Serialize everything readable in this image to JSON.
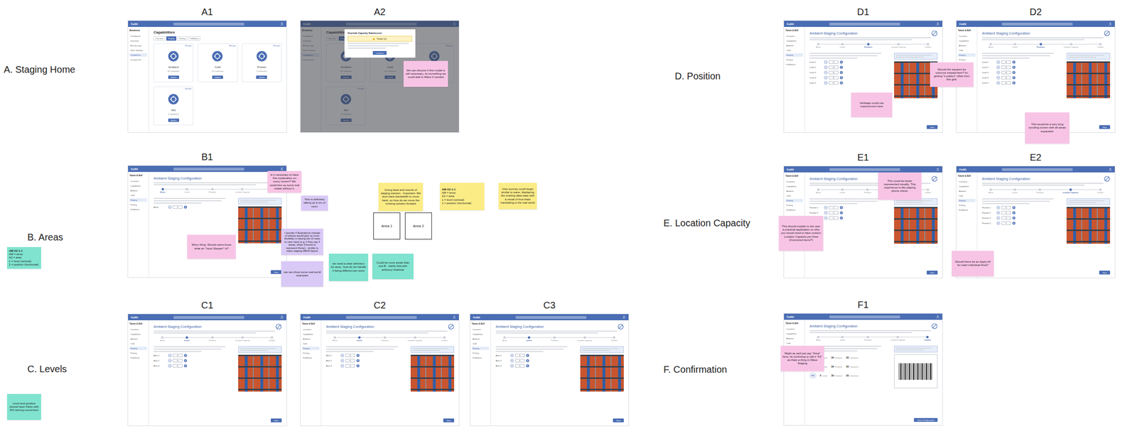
{
  "sections": [
    "A. Staging Home",
    "B. Areas",
    "C. Levels",
    "D. Position",
    "E. Location Capacity",
    "F. Confirmation"
  ],
  "app": {
    "brand": "Fulfill"
  },
  "sidebars": {
    "home": {
      "store": "Benamout",
      "items": [
        {
          "label": "Dashboard",
          "selected": false
        },
        {
          "label": "Inventory",
          "selected": false
        },
        {
          "label": "Activity Logs",
          "selected": false
        },
        {
          "label": "Store Settings",
          "selected": false
        },
        {
          "label": "Capabilities",
          "selected": true
        },
        {
          "label": "Location IDs",
          "selected": false
        }
      ]
    },
    "config": {
      "store": "Tatum & Bell",
      "items": [
        {
          "label": "Locations",
          "selected": false
        },
        {
          "label": "Capabilities",
          "selected": false
        },
        {
          "label": "Ambient",
          "selected": false
        },
        {
          "label": "Cold",
          "selected": false
        },
        {
          "label": "Staging",
          "selected": true
        },
        {
          "label": "Picking",
          "selected": false
        },
        {
          "label": "Fulfillment",
          "selected": false
        }
      ]
    }
  },
  "capabilities": {
    "title": "Capabilities",
    "tabs": [
      {
        "label": "Overview",
        "selected": false
      },
      {
        "label": "Staging",
        "selected": true
      },
      {
        "label": "Picking",
        "selected": false
      },
      {
        "label": "Fulfillment",
        "selected": false
      }
    ],
    "cards": [
      {
        "name": "Ambient",
        "count": "60 Containers",
        "manage": "Manage",
        "action": "Update"
      },
      {
        "name": "Cold",
        "count": "10 Containers",
        "manage": "Manage",
        "action": "Update"
      },
      {
        "name": "Frozen",
        "count": "5 Containers",
        "manage": "Manage",
        "action": "Update"
      },
      {
        "name": "Hot",
        "count": "3 Containers",
        "manage": "Manage",
        "action": "Update"
      }
    ]
  },
  "modal": {
    "title": "Override Capacity Submission",
    "alert": "Heads Up!",
    "button": "Continue"
  },
  "config": {
    "heading": "Ambient Staging Configuration"
  },
  "screens": [
    {
      "label": "A1",
      "kind": "home",
      "sidebar": "home",
      "modal": false
    },
    {
      "label": "A2",
      "kind": "home",
      "sidebar": "home",
      "modal": true
    },
    {
      "label": "B1",
      "kind": "config",
      "sidebar": "config",
      "modal": false,
      "button": "Next",
      "steps": [
        {
          "label": "Areas",
          "selected": true
        },
        {
          "label": "Levels",
          "selected": false
        },
        {
          "label": "Positions",
          "selected": false
        },
        {
          "label": "Location Capacity",
          "selected": false
        },
        {
          "label": "Confirm",
          "selected": false
        }
      ],
      "rows": [
        {
          "label": "Areas",
          "value": "2"
        }
      ]
    },
    {
      "label": "C1",
      "kind": "config",
      "sidebar": "config",
      "modal": false,
      "button": "Next",
      "steps": [
        {
          "label": "Areas",
          "selected": false
        },
        {
          "label": "Levels",
          "selected": true
        },
        {
          "label": "Positions",
          "selected": false
        },
        {
          "label": "Location Capacity",
          "selected": false
        },
        {
          "label": "Confirm",
          "selected": false
        }
      ],
      "rows": [
        {
          "label": "Area 1",
          "value": "5"
        },
        {
          "label": "Area 2",
          "value": "5"
        },
        {
          "label": "Area 3",
          "value": "5"
        }
      ]
    },
    {
      "label": "C2",
      "kind": "config",
      "sidebar": "config",
      "modal": false,
      "button": "Next",
      "steps": [
        {
          "label": "Areas",
          "selected": false
        },
        {
          "label": "Levels",
          "selected": true
        },
        {
          "label": "Positions",
          "selected": false
        },
        {
          "label": "Location Capacity",
          "selected": false
        },
        {
          "label": "Confirm",
          "selected": false
        }
      ],
      "rows": [
        {
          "label": "Area 1",
          "value": "5"
        },
        {
          "label": "Area 2",
          "value": "5"
        },
        {
          "label": "Area 3",
          "value": "5"
        }
      ]
    },
    {
      "label": "C3",
      "kind": "config",
      "sidebar": "config",
      "modal": false,
      "button": "Next",
      "steps": [
        {
          "label": "Areas",
          "selected": false
        },
        {
          "label": "Levels",
          "selected": true
        },
        {
          "label": "Positions",
          "selected": false
        },
        {
          "label": "Location Capacity",
          "selected": false
        },
        {
          "label": "Confirm",
          "selected": false
        }
      ],
      "rows": [
        {
          "label": "Area 1",
          "value": "5"
        },
        {
          "label": "Area 2",
          "value": "5"
        },
        {
          "label": "Area 3",
          "value": "5"
        }
      ]
    },
    {
      "label": "D1",
      "kind": "config",
      "sidebar": "config",
      "modal": false,
      "button": "Next",
      "steps": [
        {
          "label": "Areas",
          "selected": false
        },
        {
          "label": "Levels",
          "selected": false
        },
        {
          "label": "Positions",
          "selected": true
        },
        {
          "label": "Location Capacity",
          "selected": false
        },
        {
          "label": "Confirm",
          "selected": false
        }
      ],
      "rows": [
        {
          "label": "Level 1",
          "value": "6"
        },
        {
          "label": "Level 2",
          "value": "6"
        },
        {
          "label": "Level 3",
          "value": "6"
        },
        {
          "label": "Level 4",
          "value": "6"
        },
        {
          "label": "Level 5",
          "value": "6"
        }
      ]
    },
    {
      "label": "D2",
      "kind": "config",
      "sidebar": "config",
      "modal": false,
      "button": "Next",
      "steps": [
        {
          "label": "Areas",
          "selected": false
        },
        {
          "label": "Levels",
          "selected": false
        },
        {
          "label": "Positions",
          "selected": true
        },
        {
          "label": "Location Capacity",
          "selected": false
        },
        {
          "label": "Confirm",
          "selected": false
        }
      ],
      "rows": [
        {
          "label": "Level 1",
          "value": "6"
        },
        {
          "label": "Level 2",
          "value": "6"
        },
        {
          "label": "Level 3",
          "value": "6"
        },
        {
          "label": "Level 4",
          "value": "6"
        },
        {
          "label": "Level 5",
          "value": "6"
        }
      ]
    },
    {
      "label": "E1",
      "kind": "config",
      "sidebar": "config",
      "modal": false,
      "button": "Next",
      "steps": [
        {
          "label": "Areas",
          "selected": false
        },
        {
          "label": "Levels",
          "selected": false
        },
        {
          "label": "Positions",
          "selected": false
        },
        {
          "label": "Location Capacity",
          "selected": true
        },
        {
          "label": "Confirm",
          "selected": false
        }
      ],
      "rows": [
        {
          "label": "Position 1",
          "value": "1"
        },
        {
          "label": "Position 2",
          "value": "1"
        },
        {
          "label": "Position 3",
          "value": "1"
        }
      ]
    },
    {
      "label": "E2",
      "kind": "config",
      "sidebar": "config",
      "modal": false,
      "button": "Next",
      "steps": [
        {
          "label": "Areas",
          "selected": false
        },
        {
          "label": "Levels",
          "selected": false
        },
        {
          "label": "Positions",
          "selected": false
        },
        {
          "label": "Location Capacity",
          "selected": true
        },
        {
          "label": "Confirm",
          "selected": false
        }
      ],
      "rows": [
        {
          "label": "Position 1",
          "value": "1"
        },
        {
          "label": "Position 2",
          "value": "1"
        },
        {
          "label": "Position 3",
          "value": "1"
        },
        {
          "label": "Position 4",
          "value": "1"
        }
      ]
    },
    {
      "label": "F1",
      "kind": "confirm",
      "sidebar": "config",
      "modal": false,
      "button": "Save Configuration",
      "steps": [
        {
          "label": "Areas",
          "selected": false
        },
        {
          "label": "Levels",
          "selected": false
        },
        {
          "label": "Positions",
          "selected": false
        },
        {
          "label": "Location Capacity",
          "selected": false
        },
        {
          "label": "Confirm",
          "selected": true
        }
      ],
      "summary": [
        {
          "badge": "A1",
          "stats": [
            {
              "value": "5",
              "label": "Levels"
            },
            {
              "value": "30",
              "label": "Positions"
            },
            {
              "value": "30",
              "label": "Containers"
            }
          ]
        },
        {
          "badge": "A2",
          "stats": [
            {
              "value": "5",
              "label": "Levels"
            },
            {
              "value": "30",
              "label": "Positions"
            },
            {
              "value": "30",
              "label": "Containers"
            }
          ]
        },
        {
          "badge": "A3",
          "stats": [
            {
              "value": "5",
              "label": "Levels"
            },
            {
              "value": "30",
              "label": "Positions"
            },
            {
              "value": "30",
              "label": "Containers"
            }
          ]
        }
      ]
    }
  ],
  "notes": [
    {
      "kind": "comment",
      "color": "#f8c4e6",
      "lines": [
        "We can discuss if this modal is still necessary, its something we could add to Wave if needed"
      ]
    },
    {
      "kind": "comment",
      "color": "#f8c4e6",
      "lines": [
        "Is it necessary to have this explanation on every screen? We could free up some real estate without it."
      ]
    },
    {
      "kind": "comment",
      "color": "#d9c9f6",
      "lines": [
        "*this is definitely taking up a ton of room"
      ]
    },
    {
      "kind": "comment",
      "color": "#f8c4e6",
      "lines": [
        "Minor thing: Should users know what an \"Input Stepper\" is?"
      ]
    },
    {
      "kind": "comment",
      "color": "#d9c9f6",
      "lines": [
        "I wonder if illustrations instead of photos would give us more flexibility in having the UI react to user input (e.g. if they say 3 areas, show 3 boxes to represent those) - similar to wave staging ABCD layout"
      ]
    },
    {
      "kind": "comment",
      "color": "#d9c9f6",
      "lines": [
        "can we show some real world examples"
      ]
    },
    {
      "kind": "comment",
      "color": "#fbec86",
      "lines": [
        "Going back and rework of staging solution - Important: We dont have bandwidth to move back, so how do we move the existing solution forward"
      ]
    },
    {
      "kind": "legend",
      "color": "#fbec86",
      "lines": [
        "AM A2-1-1",
        "AM = temp",
        "A2 = area",
        "1 = level (vertical)",
        "1 = position (horizontal)"
      ]
    },
    {
      "kind": "comment",
      "color": "#fbec86",
      "lines": [
        "User journey could begin similar to wave, displaying the existing data state with a visual of how thats translating to the real world"
      ]
    },
    {
      "kind": "comment",
      "color": "#7fe3cf",
      "lines": [
        "we need a clear definition for area - how do we handle it being different per store"
      ]
    },
    {
      "kind": "comment",
      "color": "#7fe3cf",
      "lines": [
        "Could be more areas than just B - clarify that with anthony/ charlotte"
      ]
    },
    {
      "kind": "legend",
      "color": "#7fe3cf",
      "lines": [
        "AM A2-1-1",
        "AM = temp",
        "A2 = area",
        "1 = level (vertical)",
        "1 = position (horizontal)"
      ]
    },
    {
      "kind": "comment",
      "color": "#7fe3cf",
      "lines": [
        "Level and position should have Parity with DS naming convention"
      ]
    },
    {
      "kind": "comment",
      "color": "#f8c4e6",
      "lines": [
        "Verbiage could use improvement here"
      ]
    },
    {
      "kind": "comment",
      "color": "#f8c4e6",
      "lines": [
        "Should the squares be columns instead here? Im getting \"Location\" vibes from this grid."
      ]
    },
    {
      "kind": "comment",
      "color": "#f8c4e6",
      "lines": [
        "This would be a very long scrolling screen with all areas expanded."
      ]
    },
    {
      "kind": "comment",
      "color": "#f8c4e6",
      "lines": [
        "This could be better represented visually. This experience is like playing phone chess."
      ]
    },
    {
      "kind": "comment",
      "color": "#f8c4e6",
      "lines": [
        "This should explain to the user a practical application on why you would need to have custom Location Capacity per Area (Oversized items?)"
      ]
    },
    {
      "kind": "comment",
      "color": "#f8c4e6",
      "lines": [
        "Should there be an Apply All for each individual Area?"
      ]
    },
    {
      "kind": "comment",
      "color": "#f8c4e6",
      "lines": [
        "Might as well just say \"Area\" here, its confusing to call it \"A1\" as thats a thing in Wave Staging"
      ]
    }
  ],
  "area_boxes": [
    "Area 1",
    "Area 2"
  ]
}
